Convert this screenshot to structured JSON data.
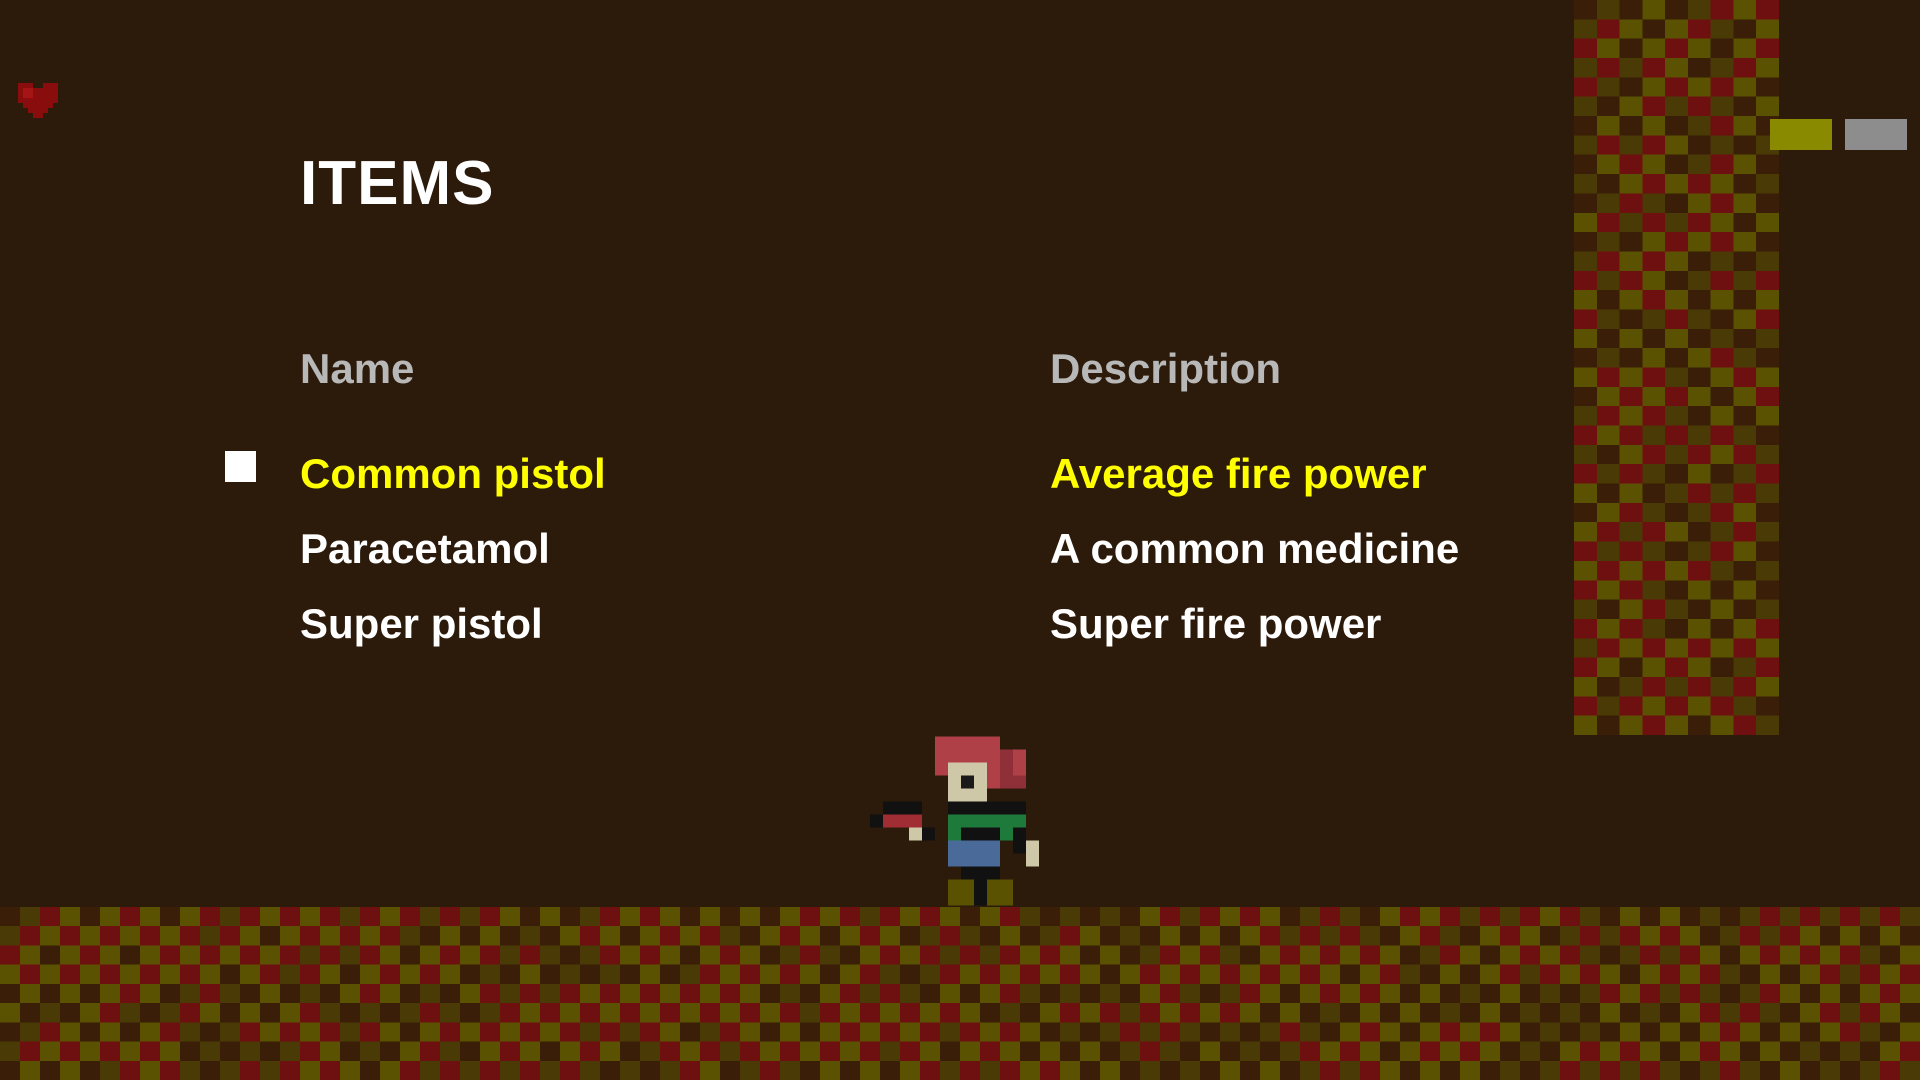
{
  "menu": {
    "title": "ITEMS",
    "columns": {
      "name": "Name",
      "description": "Description"
    },
    "selected_index": 0,
    "items": [
      {
        "name": "Common pistol",
        "description": "Average fire power"
      },
      {
        "name": "Paracetamol",
        "description": "A common medicine"
      },
      {
        "name": "Super pistol",
        "description": "Super fire power"
      }
    ]
  },
  "hud": {
    "health_icon": "heart-icon",
    "indicators": [
      {
        "icon": "ammo-indicator",
        "color": "#8a8a00"
      },
      {
        "icon": "ammo-indicator",
        "color": "#8d8d8d"
      }
    ]
  },
  "colors": {
    "background": "#2c1a0b",
    "selected_text": "#ffff00",
    "normal_text": "#ffffff",
    "header_text": "#b8b8b8",
    "tile_palette": [
      "#6e1010",
      "#5a5200",
      "#3a1e08",
      "#4a3a06"
    ]
  }
}
